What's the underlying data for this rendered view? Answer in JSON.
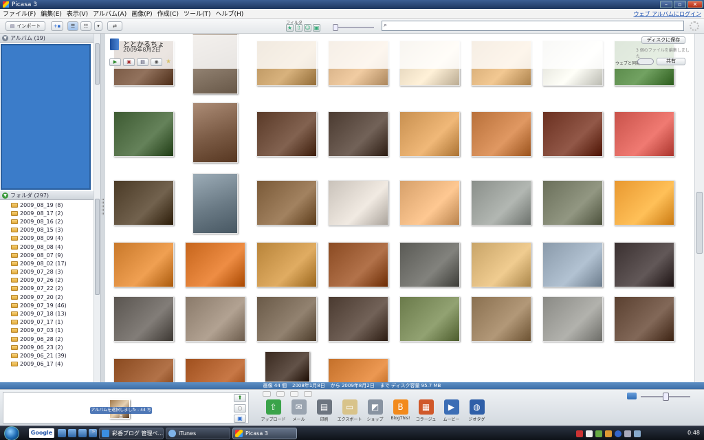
{
  "window": {
    "title": "Picasa 3"
  },
  "menu": {
    "items": [
      "ファイル(F)",
      "編集(E)",
      "表示(V)",
      "アルバム(A)",
      "画像(P)",
      "作成(C)",
      "ツール(T)",
      "ヘルプ(H)"
    ],
    "web_login": "ウェブ アルバムにログイン"
  },
  "toolbar": {
    "import_label": "インポート",
    "filter_label": "フィルタ",
    "search_placeholder": ""
  },
  "left_panel": {
    "albums_header": "アルバム (19)",
    "folders_header": "フォルダ (297)",
    "folders": [
      "2009_08_19 (8)",
      "2009_08_17 (2)",
      "2009_08_16 (2)",
      "2009_08_15 (3)",
      "2009_08_09 (4)",
      "2009_08_08 (4)",
      "2009_08_07 (9)",
      "2009_08_02 (17)",
      "2009_07_28 (3)",
      "2009_07_26 (2)",
      "2009_07_22 (2)",
      "2009_07_20 (2)",
      "2009_07_19 (46)",
      "2009_07_18 (13)",
      "2009_07_17 (1)",
      "2009_07_03 (1)",
      "2009_06_28 (2)",
      "2009_06_23 (2)",
      "2009_06_21 (39)",
      "2009_06_17 (4)"
    ]
  },
  "album": {
    "title": "ととかるちょ",
    "date": "2009年8月2日",
    "save_disk": "ディスクに保存",
    "edit_note": "3 個のファイルを編集しました",
    "web_sync": "ウェブと同期",
    "share": "共有"
  },
  "status": {
    "count": "画像 44 個",
    "from": "2008年1月8日",
    "to": "から 2009年8月2日",
    "disk": "まで ディスク容量 95.7 MB"
  },
  "tray": {
    "selection_note": "アルバムを選択しました - 44 写真",
    "actions": [
      {
        "label": "アップロード",
        "icon": "upload-icon",
        "color": "#3aa34a",
        "glyph": "⇧"
      },
      {
        "label": "メール",
        "icon": "mail-icon",
        "color": "#9aa4b0",
        "glyph": "✉"
      },
      {
        "label": "印刷",
        "icon": "print-icon",
        "color": "#6d7580",
        "glyph": "▤"
      },
      {
        "label": "エクスポート",
        "icon": "export-folder-icon",
        "color": "#d8c38a",
        "glyph": "▭"
      },
      {
        "label": "ショップ",
        "icon": "shop-icon",
        "color": "#8893a1",
        "glyph": "◩"
      },
      {
        "label": "BlogThis!",
        "icon": "blogger-icon",
        "color": "#f28a1c",
        "glyph": "B"
      },
      {
        "label": "コラージュ",
        "icon": "collage-icon",
        "color": "#d0582a",
        "glyph": "▦"
      },
      {
        "label": "ムービー",
        "icon": "movie-icon",
        "color": "#3b6db5",
        "glyph": "▶"
      },
      {
        "label": "ジオタグ",
        "icon": "geotag-icon",
        "color": "#2f5fa8",
        "glyph": "◍"
      }
    ]
  },
  "taskbar": {
    "google": "Google",
    "tasks": [
      "彩香ブログ 管理ペ...",
      "iTunes",
      "Picasa 3"
    ],
    "clock": "0:48"
  },
  "photo_colors": [
    [
      "#6a4a35",
      "#8a7a6a",
      "#b08a55",
      "#c9a47a",
      "#d8c9b0",
      "#caa06a",
      "#d9d9d0",
      "#4a7a3a"
    ],
    [
      "#3d5a32",
      "#7a5a44",
      "#5a3a28",
      "#4a3a30",
      "#c89050",
      "#b8703a",
      "#6a3020",
      "#c8524a"
    ],
    [
      "#4a3a26",
      "#6a7a85",
      "#7a5a38",
      "#c9c2ba",
      "#d6a06a",
      "#8a8f8a",
      "#6a6f5a",
      "#e89830"
    ],
    [
      "#c8782a",
      "#c6651c",
      "#b8843a",
      "#8a4a22",
      "#5a5a55",
      "#c8a468",
      "#8a9aaa",
      "#3a3030"
    ],
    [
      "#5a5550",
      "#8a7a6a",
      "#6a5a48",
      "#4a3a30",
      "#6a7a4a",
      "#8a7050",
      "#8a8a85",
      "#5a4030"
    ],
    [
      "#8a4a20",
      "#a0501e",
      "#3a2a20",
      "#c4702a",
      "#ffffff",
      "#ffffff",
      "#ffffff",
      "#ffffff"
    ]
  ]
}
